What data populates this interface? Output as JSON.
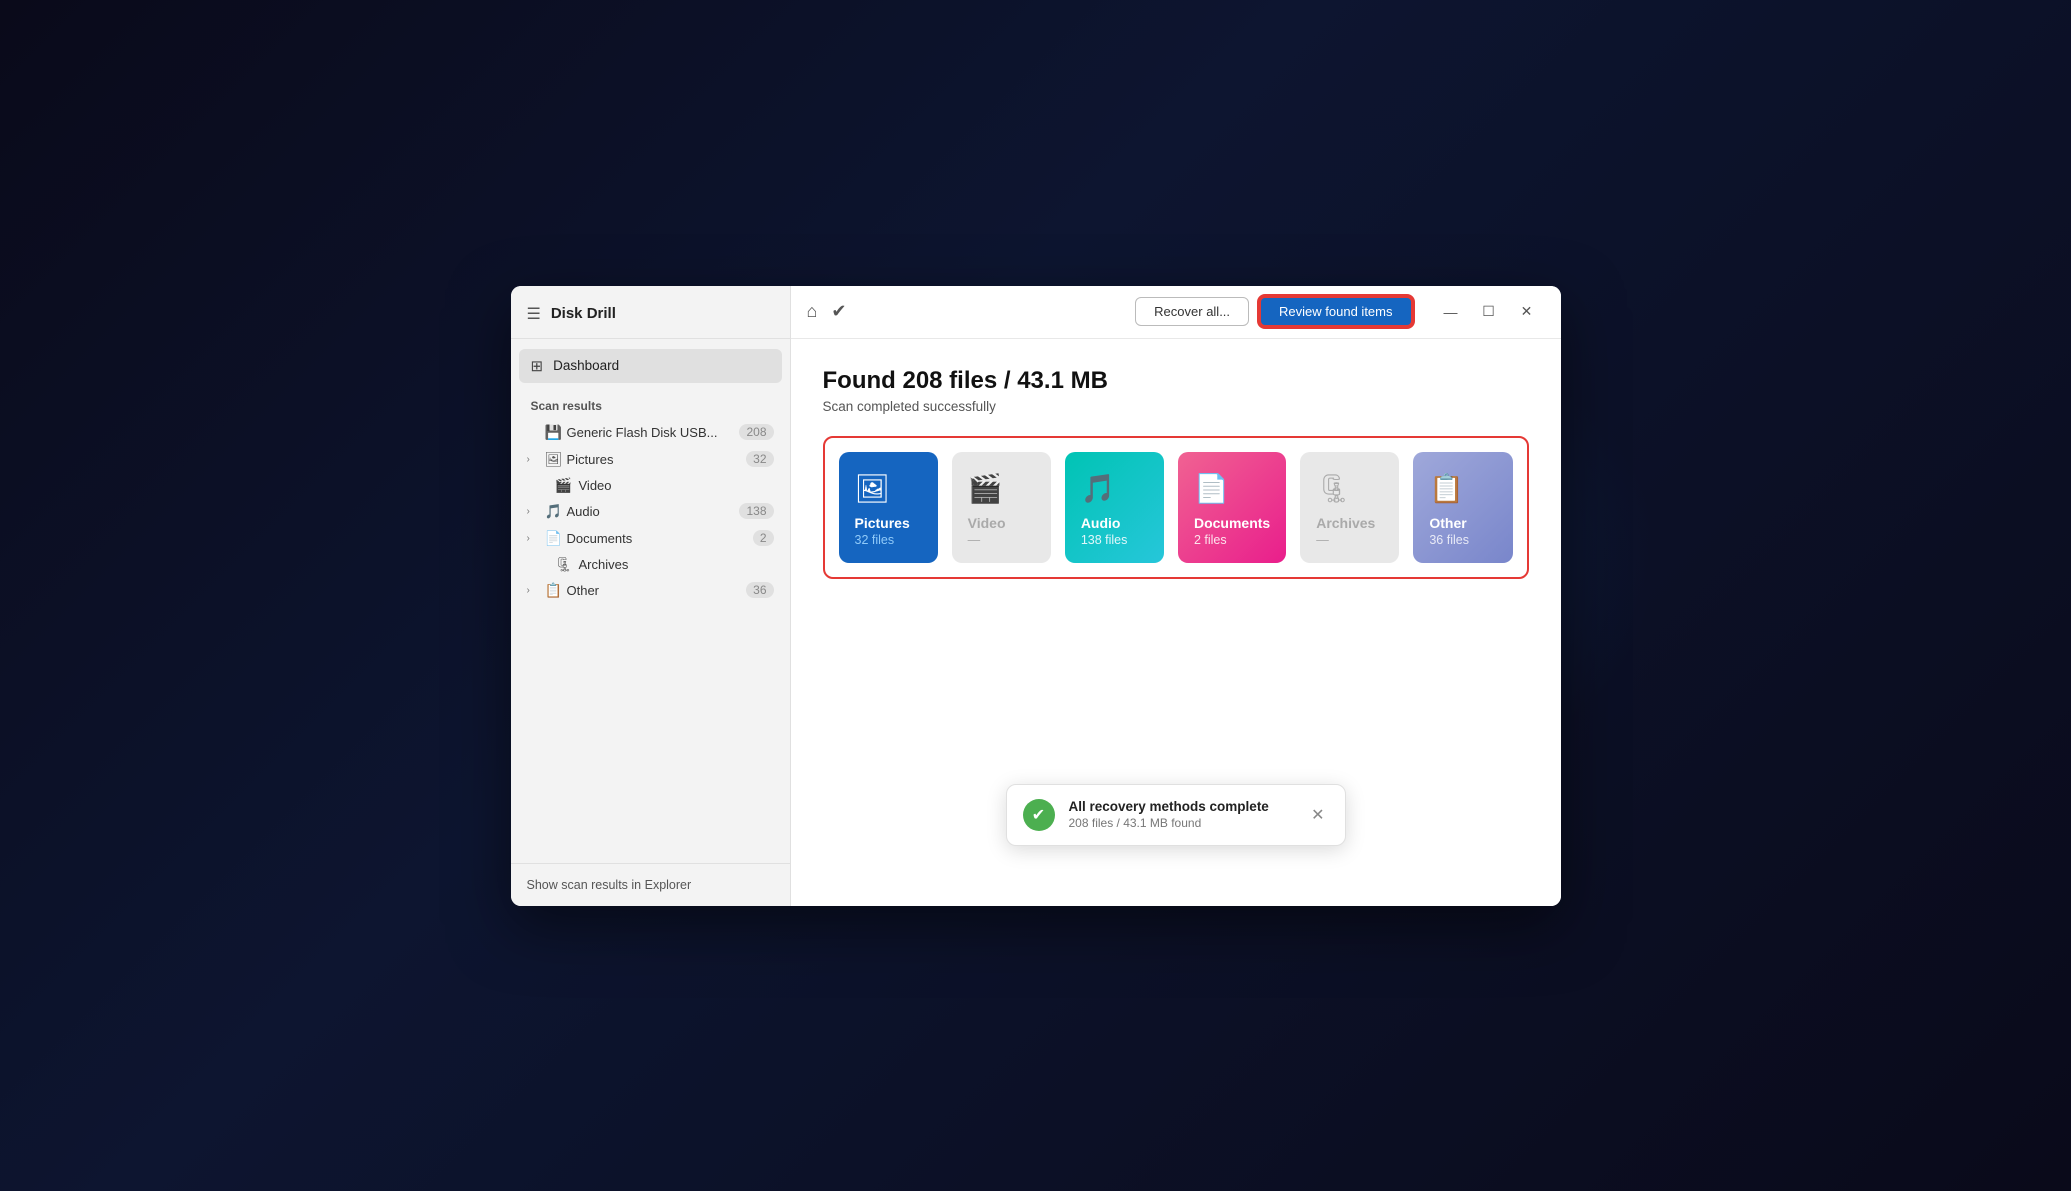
{
  "app": {
    "title": "Disk Drill",
    "hamburger_label": "☰"
  },
  "sidebar": {
    "dashboard_label": "Dashboard",
    "scan_results_label": "Scan results",
    "items": [
      {
        "id": "generic-flash-disk",
        "label": "Generic Flash Disk USB...",
        "count": "208",
        "icon": "💾",
        "has_chevron": false
      },
      {
        "id": "pictures",
        "label": "Pictures",
        "count": "32",
        "icon": "🖼",
        "has_chevron": true
      },
      {
        "id": "video",
        "label": "Video",
        "count": "",
        "icon": "🎬",
        "has_chevron": false,
        "indent": true
      },
      {
        "id": "audio",
        "label": "Audio",
        "count": "138",
        "icon": "🎵",
        "has_chevron": true
      },
      {
        "id": "documents",
        "label": "Documents",
        "count": "2",
        "icon": "📄",
        "has_chevron": true
      },
      {
        "id": "archives",
        "label": "Archives",
        "count": "",
        "icon": "🗜",
        "has_chevron": false,
        "indent": true
      },
      {
        "id": "other",
        "label": "Other",
        "count": "36",
        "icon": "📋",
        "has_chevron": true
      }
    ],
    "footer_label": "Show scan results in Explorer"
  },
  "titlebar": {
    "recover_all_label": "Recover all...",
    "review_found_label": "Review found items",
    "win_min": "—",
    "win_max": "☐",
    "win_close": "✕"
  },
  "main": {
    "found_title": "Found 208 files / 43.1 MB",
    "scan_status": "Scan completed successfully",
    "categories": [
      {
        "id": "pictures",
        "name": "Pictures",
        "files": "32 files",
        "icon": "🖼",
        "class": "pictures"
      },
      {
        "id": "video",
        "name": "Video",
        "files": "—",
        "icon": "🎬",
        "class": "video"
      },
      {
        "id": "audio",
        "name": "Audio",
        "files": "138 files",
        "icon": "🎵",
        "class": "audio"
      },
      {
        "id": "documents",
        "name": "Documents",
        "files": "2 files",
        "icon": "📄",
        "class": "documents"
      },
      {
        "id": "archives",
        "name": "Archives",
        "files": "—",
        "icon": "🗜",
        "class": "archives"
      },
      {
        "id": "other",
        "name": "Other",
        "files": "36 files",
        "icon": "📋",
        "class": "other"
      }
    ]
  },
  "toast": {
    "title": "All recovery methods complete",
    "subtitle": "208 files / 43.1 MB found",
    "close_label": "✕"
  }
}
